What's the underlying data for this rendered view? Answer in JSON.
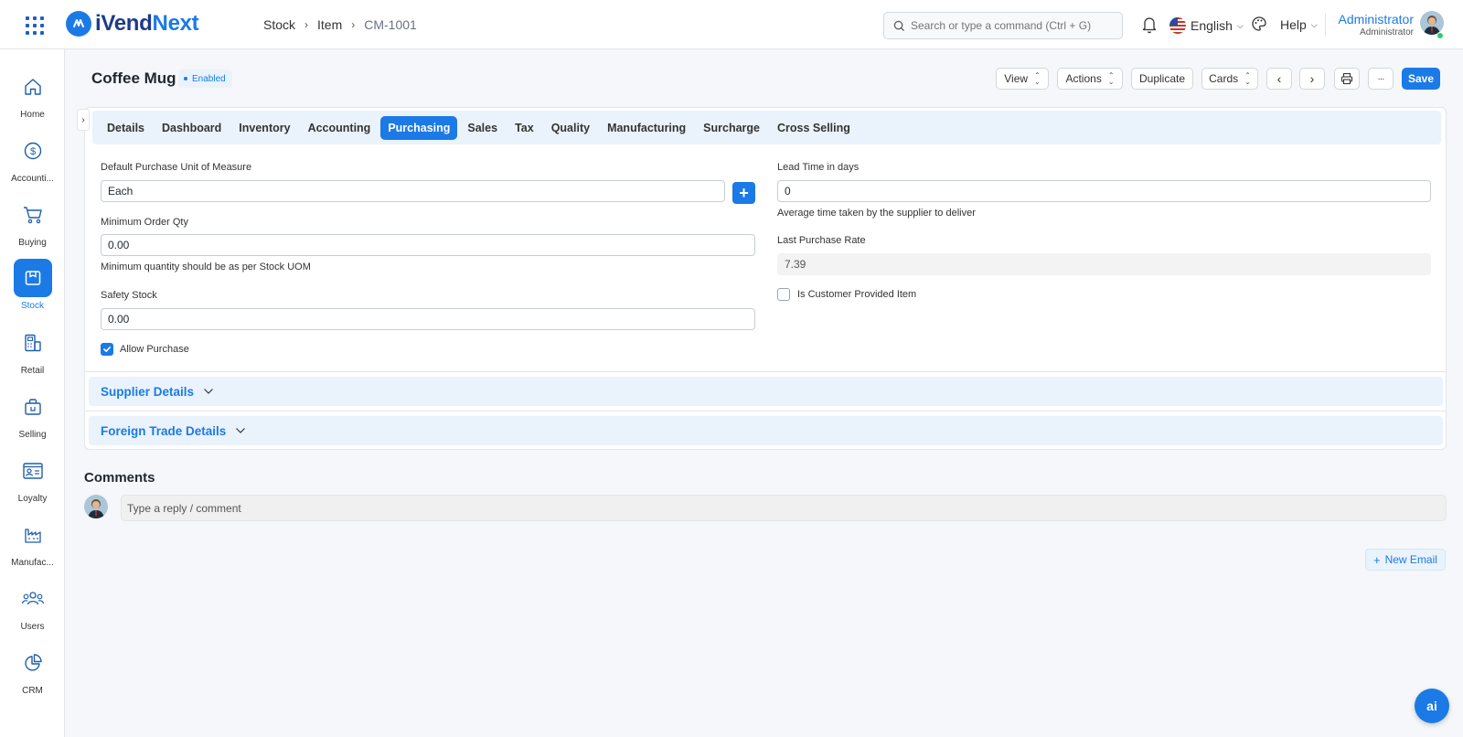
{
  "app": {
    "brand_part1": "iVend",
    "brand_part2": "Next",
    "accent_color": "#1b7ae6"
  },
  "breadcrumb": [
    "Stock",
    "Item",
    "CM-1001"
  ],
  "search": {
    "placeholder": "Search or type a command (Ctrl + G)"
  },
  "topbar": {
    "language": "English",
    "help": "Help",
    "user_name": "Administrator",
    "user_role": "Administrator"
  },
  "sidebar": {
    "items": [
      {
        "label": "Home",
        "icon": "home-icon"
      },
      {
        "label": "Accounti...",
        "icon": "dollar-icon"
      },
      {
        "label": "Buying",
        "icon": "cart-icon"
      },
      {
        "label": "Stock",
        "icon": "box-icon",
        "active": true
      },
      {
        "label": "Retail",
        "icon": "pos-icon"
      },
      {
        "label": "Selling",
        "icon": "bag-icon"
      },
      {
        "label": "Loyalty",
        "icon": "id-card-icon"
      },
      {
        "label": "Manufac...",
        "icon": "factory-icon"
      },
      {
        "label": "Users",
        "icon": "users-icon"
      },
      {
        "label": "CRM",
        "icon": "pie-icon"
      }
    ]
  },
  "doc": {
    "title": "Coffee Mug",
    "status": "Enabled",
    "buttons": {
      "view": "View",
      "actions": "Actions",
      "duplicate": "Duplicate",
      "cards": "Cards",
      "more": "···",
      "save": "Save"
    }
  },
  "tabs": [
    "Details",
    "Dashboard",
    "Inventory",
    "Accounting",
    "Purchasing",
    "Sales",
    "Tax",
    "Quality",
    "Manufacturing",
    "Surcharge",
    "Cross Selling"
  ],
  "active_tab": "Purchasing",
  "form": {
    "default_uom_label": "Default Purchase Unit of Measure",
    "default_uom_value": "Each",
    "min_order_label": "Minimum Order Qty",
    "min_order_value": "0.00",
    "min_order_help": "Minimum quantity should be as per Stock UOM",
    "safety_stock_label": "Safety Stock",
    "safety_stock_value": "0.00",
    "allow_purchase_label": "Allow Purchase",
    "allow_purchase_checked": true,
    "lead_time_label": "Lead Time in days",
    "lead_time_value": "0",
    "lead_time_help": "Average time taken by the supplier to deliver",
    "last_rate_label": "Last Purchase Rate",
    "last_rate_value": "7.39",
    "customer_provided_label": "Is Customer Provided Item",
    "customer_provided_checked": false
  },
  "sections": {
    "supplier": "Supplier Details",
    "foreign_trade": "Foreign Trade Details"
  },
  "comments": {
    "title": "Comments",
    "placeholder": "Type a reply / comment",
    "new_email": "New Email"
  },
  "ai_button": "ai"
}
